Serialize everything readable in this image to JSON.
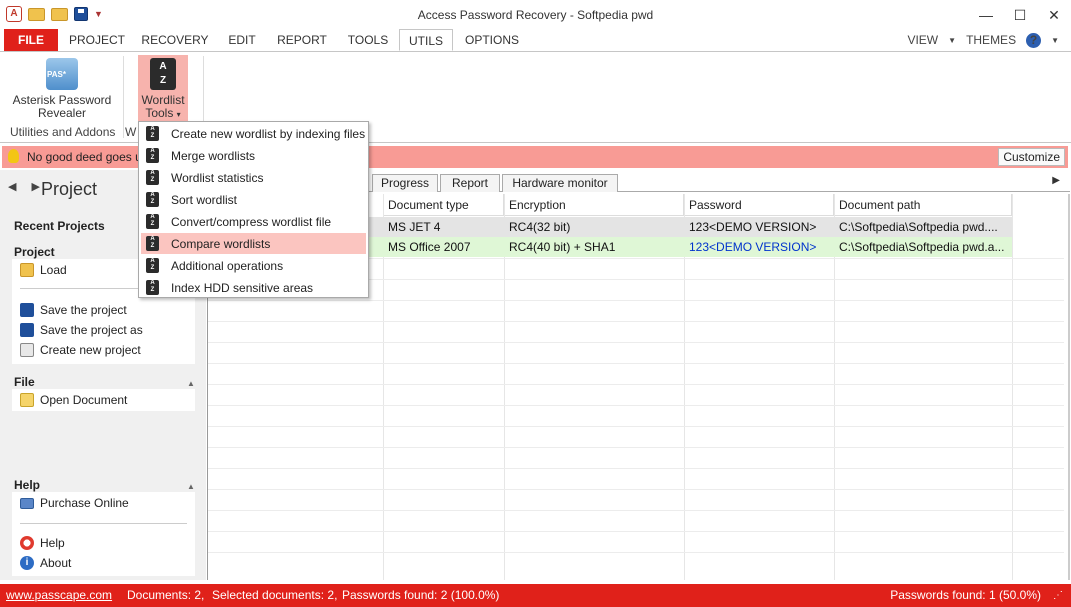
{
  "window": {
    "title": "Access Password Recovery - Softpedia pwd",
    "controls": [
      "—",
      "☐",
      "✕"
    ]
  },
  "ribbon_tabs": [
    "FILE",
    "PROJECT",
    "RECOVERY",
    "EDIT",
    "REPORT",
    "TOOLS",
    "UTILS",
    "OPTIONS"
  ],
  "ribbon_right": {
    "view": "VIEW",
    "themes": "THEMES",
    "help": "?"
  },
  "ribbon": {
    "asterisk_label_1": "Asterisk Password",
    "asterisk_label_2": "Revealer",
    "wordlist_label_1": "Wordlist",
    "wordlist_label_2": "Tools",
    "wordlist_caret": "▾",
    "group_label": "Utilities and Addons",
    "group_label_2": "W"
  },
  "notice": {
    "text": "No good deed goes u",
    "customize": "Customize"
  },
  "left": {
    "nav": "◀ ▶",
    "title": "Project",
    "recent": "Recent Projects",
    "project_head": "Project",
    "load": "Load",
    "save": "Save the project",
    "save_as": "Save the project as",
    "create": "Create new project",
    "file_head": "File",
    "open_doc": "Open Document",
    "help_head": "Help",
    "purchase": "Purchase Online",
    "help": "Help",
    "about": "About"
  },
  "content_tabs": [
    "Progress",
    "Report",
    "Hardware monitor"
  ],
  "table": {
    "columns": [
      "Document type",
      "Encryption",
      "Password",
      "Document path"
    ],
    "rows": [
      [
        "MS JET 4",
        "RC4(32 bit)",
        "123<DEMO VERSION>",
        "C:\\Softpedia\\Softpedia pwd...."
      ],
      [
        "MS Office 2007",
        "RC4(40 bit) + SHA1",
        "123<DEMO VERSION>",
        "C:\\Softpedia\\Softpedia pwd.a..."
      ]
    ]
  },
  "menu": {
    "items": [
      "Create new wordlist by indexing files",
      "Merge wordlists",
      "Wordlist statistics",
      "Sort wordlist",
      "Convert/compress wordlist file",
      "Compare wordlists",
      "Additional operations",
      "Index HDD sensitive areas"
    ],
    "highlighted_index": 5
  },
  "status": {
    "link": "www.passcape.com",
    "documents": "Documents: 2,",
    "selected": "Selected documents: 2,",
    "found": "Passwords found: 2 (100.0%)",
    "found_right": "Passwords found: 1 (50.0%)"
  },
  "colors": {
    "accent": "#e0211a",
    "row_selected": "#e4e4e4",
    "row_green": "#dff7d6",
    "password_blue": "#0033cc"
  }
}
